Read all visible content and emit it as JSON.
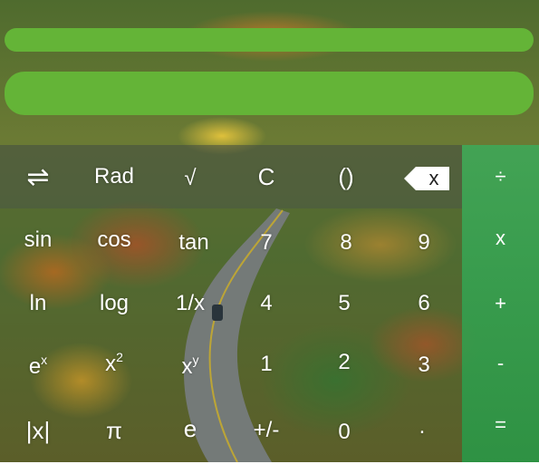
{
  "keypad": {
    "row1": {
      "swap": "⇌",
      "rad": "Rad",
      "sqrt": "√",
      "clear": "C",
      "parens": "()",
      "backspace": "x"
    },
    "row2": {
      "sin": "sin",
      "cos": "cos",
      "tan": "tan",
      "k7": "7",
      "k8": "8",
      "k9": "9"
    },
    "row3": {
      "ln": "ln",
      "log": "log",
      "inv": "1/x",
      "k4": "4",
      "k5": "5",
      "k6": "6"
    },
    "row4": {
      "ex_base": "e",
      "ex_sup": "x",
      "x2_base": "x",
      "x2_sup": "2",
      "xy_base": "x",
      "xy_sup": "y",
      "k1": "1",
      "k2": "2",
      "k3": "3"
    },
    "row5": {
      "abs": "|x|",
      "pi": "π",
      "e": "e",
      "sign": "+/-",
      "k0": "0",
      "dot": "."
    }
  },
  "operators": {
    "divide": "÷",
    "multiply": "x",
    "plus": "+",
    "minus": "-",
    "equals": "="
  },
  "colors": {
    "display_bar": "#64b437",
    "operator_column": "#3aa55a"
  }
}
